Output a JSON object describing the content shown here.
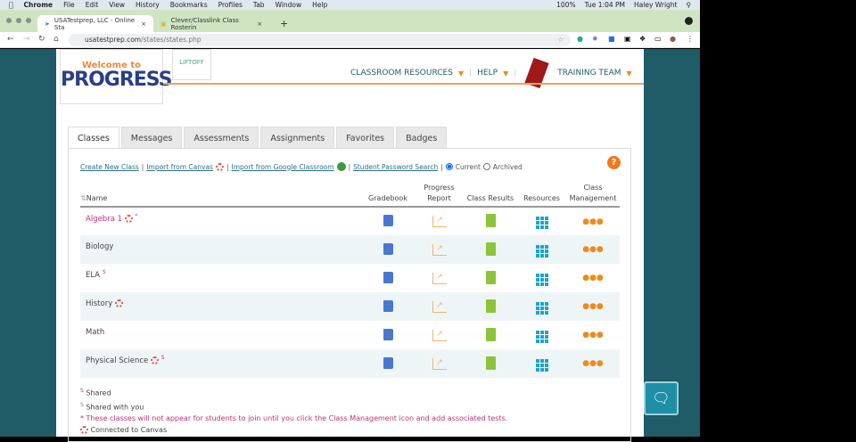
{
  "menubar": {
    "app": "Chrome",
    "items": [
      "File",
      "Edit",
      "View",
      "History",
      "Bookmarks",
      "Profiles",
      "Tab",
      "Window",
      "Help"
    ],
    "status": {
      "battery": "100%",
      "time": "Tue 1:04 PM",
      "user": "Haley Wright"
    }
  },
  "browser": {
    "tabs": [
      {
        "title": "USATestprep, LLC - Online Sta"
      },
      {
        "title": "Clever/Classlink Class Rosterin"
      }
    ],
    "new_tab": "+",
    "url_host": "usatestprep.com",
    "url_path": "/states/states.php"
  },
  "site": {
    "logo_line1": "Welcome to",
    "logo_line2": "PROGRESS",
    "logo2": "LIFTOFF",
    "nav": [
      "CLASSROOM RESOURCES",
      "HELP",
      "TRAINING TEAM"
    ]
  },
  "tabs": [
    "Classes",
    "Messages",
    "Assessments",
    "Assignments",
    "Favorites",
    "Badges"
  ],
  "actions": {
    "create": "Create New Class",
    "canvas": "Import from Canvas",
    "google": "Import from Google Classroom",
    "password": "Student Password Search",
    "current": "Current",
    "archived": "Archived",
    "help": "?"
  },
  "table": {
    "headers": {
      "name": "Name",
      "gradebook": "Gradebook",
      "progress": "Progress Report",
      "results": "Class Results",
      "resources": "Resources",
      "management": "Class Management"
    },
    "rows": [
      {
        "name": "Algebra 1",
        "canvas": true,
        "mark": "*",
        "pink": true
      },
      {
        "name": "Biology",
        "mark": ""
      },
      {
        "name": "ELA",
        "mark": "S"
      },
      {
        "name": "History",
        "canvas": true,
        "mark": ""
      },
      {
        "name": "Math",
        "mark": ""
      },
      {
        "name": "Physical Science",
        "canvas": true,
        "mark": "S"
      }
    ]
  },
  "legend": {
    "shared_mark": "S",
    "shared": "Shared",
    "shared_with_mark": "S",
    "shared_with": "Shared with you",
    "note": "* These classes will not appear for students to join until you click the Class Management icon and add associated tests.",
    "canvas": "Connected to Canvas"
  },
  "colors": {
    "teal": "#1f5c68",
    "accent": "#f08a1c",
    "pink": "#c0307a"
  }
}
